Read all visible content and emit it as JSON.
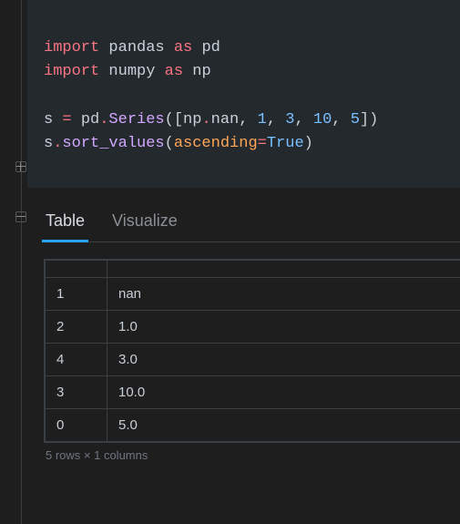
{
  "code": {
    "tokens": [
      [
        [
          "kw",
          "import"
        ],
        [
          "sp",
          " "
        ],
        [
          "mod",
          "pandas"
        ],
        [
          "sp",
          " "
        ],
        [
          "kw",
          "as"
        ],
        [
          "sp",
          " "
        ],
        [
          "mod",
          "pd"
        ]
      ],
      [
        [
          "kw",
          "import"
        ],
        [
          "sp",
          " "
        ],
        [
          "mod",
          "numpy"
        ],
        [
          "sp",
          " "
        ],
        [
          "kw",
          "as"
        ],
        [
          "sp",
          " "
        ],
        [
          "mod",
          "np"
        ]
      ],
      [],
      [
        [
          "id",
          "s"
        ],
        [
          "sp",
          " "
        ],
        [
          "op",
          "="
        ],
        [
          "sp",
          " "
        ],
        [
          "mod",
          "pd"
        ],
        [
          "op",
          "."
        ],
        [
          "fn",
          "Series"
        ],
        [
          "paren",
          "("
        ],
        [
          "paren",
          "["
        ],
        [
          "mod",
          "np"
        ],
        [
          "op",
          "."
        ],
        [
          "id",
          "nan"
        ],
        [
          "comma",
          ","
        ],
        [
          "sp",
          " "
        ],
        [
          "num",
          "1"
        ],
        [
          "comma",
          ","
        ],
        [
          "sp",
          " "
        ],
        [
          "num",
          "3"
        ],
        [
          "comma",
          ","
        ],
        [
          "sp",
          " "
        ],
        [
          "num",
          "10"
        ],
        [
          "comma",
          ","
        ],
        [
          "sp",
          " "
        ],
        [
          "num",
          "5"
        ],
        [
          "paren",
          "]"
        ],
        [
          "paren",
          ")"
        ]
      ],
      [
        [
          "id",
          "s"
        ],
        [
          "op",
          "."
        ],
        [
          "fn",
          "sort_values"
        ],
        [
          "paren",
          "("
        ],
        [
          "arg",
          "ascending"
        ],
        [
          "op",
          "="
        ],
        [
          "true",
          "True"
        ],
        [
          "paren",
          ")"
        ]
      ]
    ]
  },
  "tabs": [
    {
      "label": "Table",
      "active": true
    },
    {
      "label": "Visualize",
      "active": false
    }
  ],
  "table": {
    "columns": [
      "",
      ""
    ],
    "rows": [
      {
        "index": "1",
        "value": "nan"
      },
      {
        "index": "2",
        "value": "1.0"
      },
      {
        "index": "4",
        "value": "3.0"
      },
      {
        "index": "3",
        "value": "10.0"
      },
      {
        "index": "0",
        "value": "5.0"
      }
    ]
  },
  "footer": "5 rows × 1 columns"
}
